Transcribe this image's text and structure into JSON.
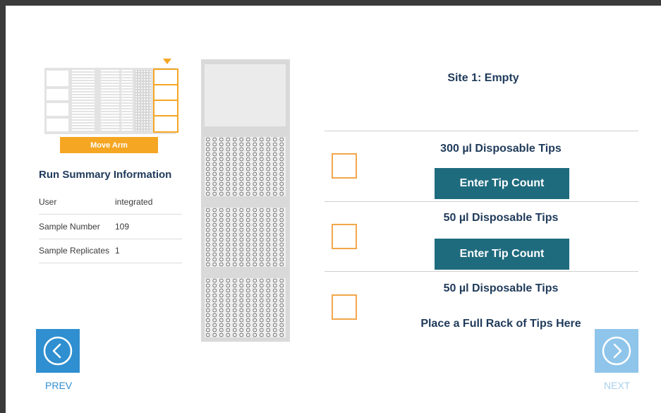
{
  "deck": {
    "move_arm_label": "Move Arm"
  },
  "run_summary": {
    "title": "Run Summary Information",
    "rows": [
      {
        "key": "User",
        "value": "integrated"
      },
      {
        "key": "Sample Number",
        "value": "109"
      },
      {
        "key": "Sample Replicates",
        "value": "1"
      }
    ]
  },
  "site": {
    "title": "Site 1: Empty",
    "positions": [
      {
        "label": "300 µl Disposable Tips",
        "action": "Enter Tip Count"
      },
      {
        "label": "50 µl Disposable Tips",
        "action": "Enter Tip Count"
      },
      {
        "label": "50 µl Disposable Tips",
        "action": "Place a Full Rack of Tips Here"
      }
    ]
  },
  "nav": {
    "prev_label": "PREV",
    "next_label": "NEXT"
  },
  "colors": {
    "accent": "#f5a623",
    "button": "#1f6b7e",
    "nav_active": "#2f8fd0",
    "nav_disabled": "#8fc5ea",
    "title_text": "#1f3a5a"
  },
  "icons": {
    "prev": "chevron-left-circle-icon",
    "next": "chevron-right-circle-icon",
    "pointer": "triangle-down-icon"
  }
}
